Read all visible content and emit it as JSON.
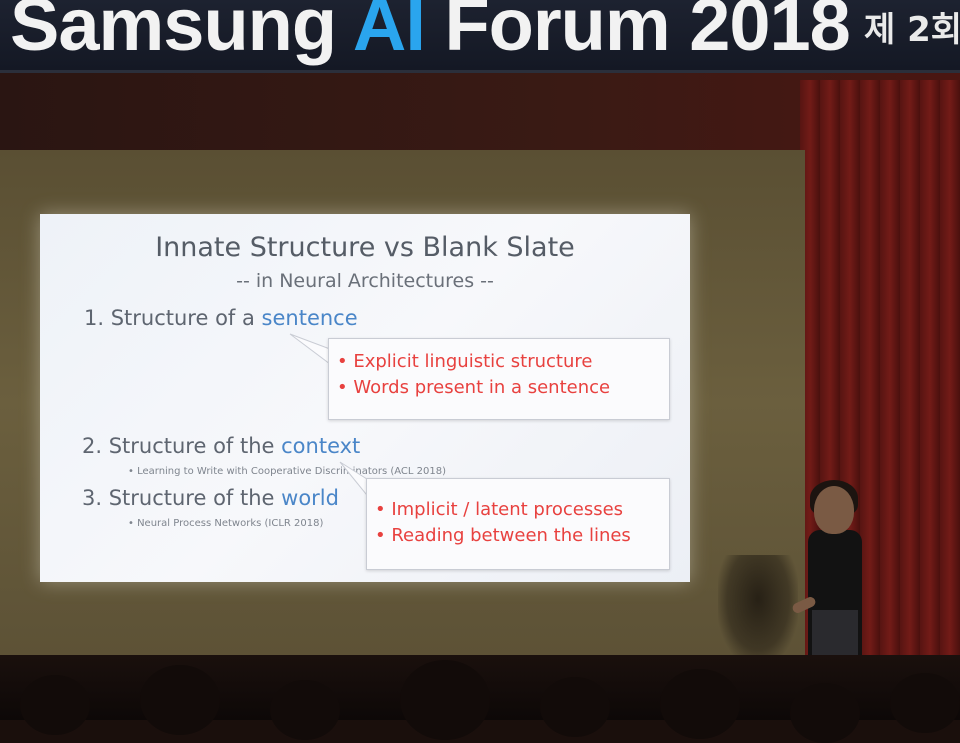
{
  "banner": {
    "title_part1": "Samsung ",
    "title_ai": "AI",
    "title_part2": " Forum 2018",
    "right_text": "제 2회"
  },
  "slide": {
    "title": "Innate Structure vs Blank Slate",
    "subtitle": "-- in Neural Architectures --",
    "items": [
      {
        "prefix": "1. Structure of a ",
        "highlight": "sentence",
        "ref": ""
      },
      {
        "prefix": "2. Structure of the ",
        "highlight": "context",
        "ref": "• Learning to Write with Cooperative Discriminators (ACL 2018)"
      },
      {
        "prefix": "3. Structure of the ",
        "highlight": "world",
        "ref": "• Neural Process Networks (ICLR 2018)"
      }
    ],
    "callouts": [
      {
        "lines": [
          "• Explicit linguistic structure",
          "• Words present in a sentence"
        ]
      },
      {
        "lines": [
          "• Implicit / latent processes",
          "• Reading between the lines"
        ]
      }
    ]
  },
  "colors": {
    "highlight": "#4a86c8",
    "callout_text": "#e8413f",
    "banner_ai": "#2aa5ee"
  }
}
